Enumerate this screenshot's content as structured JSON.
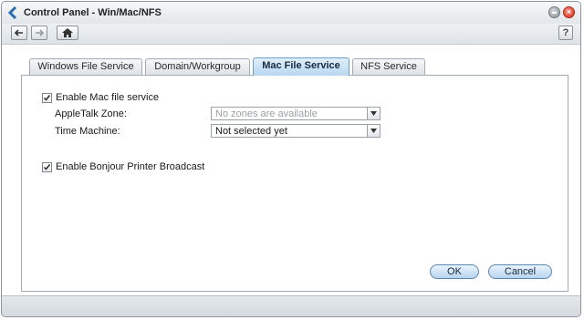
{
  "window": {
    "title": "Control Panel - Win/Mac/NFS"
  },
  "toolbar": {
    "help_label": "?"
  },
  "tabs": [
    {
      "label": "Windows File Service",
      "active": false
    },
    {
      "label": "Domain/Workgroup",
      "active": false
    },
    {
      "label": "Mac File Service",
      "active": true
    },
    {
      "label": "NFS Service",
      "active": false
    }
  ],
  "form": {
    "enable_mac": {
      "label": "Enable Mac file service",
      "checked": true
    },
    "appletalk": {
      "label": "AppleTalk Zone:",
      "value": "No zones are available",
      "disabled": true
    },
    "time_machine": {
      "label": "Time Machine:",
      "value": "Not selected yet"
    },
    "bonjour": {
      "label": "Enable Bonjour Printer Broadcast",
      "checked": true
    }
  },
  "buttons": {
    "ok": "OK",
    "cancel": "Cancel"
  },
  "colors": {
    "accent": "#b9d5ee",
    "close": "#d2321e"
  }
}
